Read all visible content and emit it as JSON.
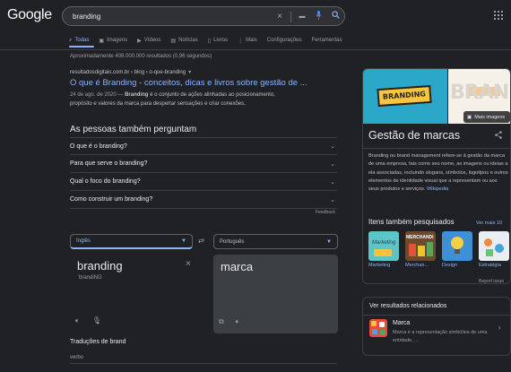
{
  "header": {
    "logo": "Google",
    "search_query": "branding",
    "clear_icon": "×",
    "keyboard_icon": "▬",
    "mic_icon": "🎤",
    "search_icon": "🔍"
  },
  "tabs": [
    {
      "label": "Todas",
      "icon": "⌕"
    },
    {
      "label": "Imagens",
      "icon": "▣"
    },
    {
      "label": "Vídeos",
      "icon": "▶"
    },
    {
      "label": "Notícias",
      "icon": "▤"
    },
    {
      "label": "Livros",
      "icon": "▯"
    },
    {
      "label": "Mais",
      "icon": "⋮"
    },
    {
      "label": "Configurações",
      "icon": ""
    },
    {
      "label": "Ferramentas",
      "icon": ""
    }
  ],
  "stats": "Aproximadamente 408.000.000 resultados (0,96 segundos)",
  "result": {
    "url": "resultadosdigitais.com.br › blog › o-que-branding",
    "title": "O que é Branding - conceitos, dicas e livros sobre gestão de ...",
    "date": "24 de ago. de 2020 —",
    "bold": "Branding",
    "snippet_a": " é o conjunto de ações alinhadas ao posicionamento,",
    "snippet_b": "propósito e valores da marca para despertar sensações e criar conexões."
  },
  "paa": {
    "heading": "As pessoas também perguntam",
    "questions": [
      "O que é o branding?",
      "Para que serve o branding?",
      "Qual o foco do branding?",
      "Como construir um branding?"
    ],
    "feedback": "Feedback"
  },
  "translate": {
    "source_lang": "Inglês",
    "target_lang": "Português",
    "source_word": "branding",
    "phonetic": "ˈbrandiNG",
    "target_word": "marca",
    "translations_heading": "Traduções de brand",
    "part_of_speech": "verbo"
  },
  "knowledge_panel": {
    "banner_text": "BRANDING",
    "bg_text": "BRAN",
    "more_images": "Mais imagens",
    "title": "Gestão de marcas",
    "description": "Branding ou brand management refere-se à gestão da marca de uma empresa, tais como seu nome, as imagens ou ideias a ela associadas, incluindo slogans, símbolos, logotipos e outros elementos de identidade visual que a representam ou aos seus produtos e serviços.",
    "source_link": "Wikipedia",
    "also_searched": "Itens também pesquisados",
    "see_more": "Ver mais 10",
    "thumbs": [
      {
        "label": "Marketing",
        "color": "#5ec5c6",
        "text": "Marketing"
      },
      {
        "label": "Merchan...",
        "color": "#6b4a2e",
        "text": "MERCHANDI"
      },
      {
        "label": "Design",
        "color": "#3d8fd6",
        "text": ""
      },
      {
        "label": "Estratégia",
        "color": "#e9eef2",
        "text": ""
      }
    ],
    "report": "Report issue"
  },
  "related": {
    "heading": "Ver resultados relacionados",
    "name": "Marca",
    "description": "Marca é a representação simbólica de uma entidade, ..."
  }
}
